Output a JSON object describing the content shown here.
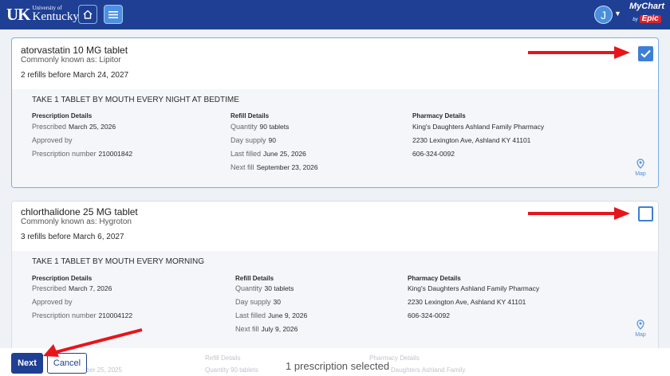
{
  "header": {
    "logo_small": "University of",
    "logo_big": "Kentucky",
    "logo_mark": "UK",
    "avatar_initial": "J",
    "brand_mychart": "MyChart",
    "brand_by": "by",
    "brand_epic": "Epic"
  },
  "prescriptions": [
    {
      "name": "atorvastatin 10 MG tablet",
      "common": "Commonly known as: Lipitor",
      "refills": "2 refills before March 24, 2027",
      "selected": true,
      "sig": "TAKE 1 TABLET BY MOUTH EVERY NIGHT AT BEDTIME",
      "prescription_details": {
        "heading": "Prescription Details",
        "prescribed_label": "Prescribed",
        "prescribed_value": "March 25, 2026",
        "approved_label": "Approved by",
        "rx_number_label": "Prescription number",
        "rx_number_value": "210001842"
      },
      "refill_details": {
        "heading": "Refill Details",
        "quantity_label": "Quantity",
        "quantity_value": "90 tablets",
        "day_supply_label": "Day supply",
        "day_supply_value": "90",
        "last_filled_label": "Last filled",
        "last_filled_value": "June 25, 2026",
        "next_fill_label": "Next fill",
        "next_fill_value": "September 23, 2026"
      },
      "pharmacy_details": {
        "heading": "Pharmacy Details",
        "name": "King's Daughters Ashland Family Pharmacy",
        "address": "2230 Lexington Ave, Ashland KY 41101",
        "phone": "606-324-0092"
      },
      "map_label": "Map"
    },
    {
      "name": "chlorthalidone 25 MG tablet",
      "common": "Commonly known as: Hygroton",
      "refills": "3 refills before March 6, 2027",
      "selected": false,
      "sig": "TAKE 1 TABLET BY MOUTH EVERY MORNING",
      "prescription_details": {
        "heading": "Prescription Details",
        "prescribed_label": "Prescribed",
        "prescribed_value": "March 7, 2026",
        "approved_label": "Approved by",
        "rx_number_label": "Prescription number",
        "rx_number_value": "210004122"
      },
      "refill_details": {
        "heading": "Refill Details",
        "quantity_label": "Quantity",
        "quantity_value": "30 tablets",
        "day_supply_label": "Day supply",
        "day_supply_value": "30",
        "last_filled_label": "Last filled",
        "last_filled_value": "June 9, 2026",
        "next_fill_label": "Next fill",
        "next_fill_value": "July 9, 2026"
      },
      "pharmacy_details": {
        "heading": "Pharmacy Details",
        "name": "King's Daughters Ashland Family Pharmacy",
        "address": "2230 Lexington Ave, Ashland KY 41101",
        "phone": "606-324-0092"
      },
      "map_label": "Map"
    }
  ],
  "ghost_row": {
    "refill_heading": "Refill Details",
    "pharmacy_heading": "Pharmacy Details",
    "date_fragment": "ber 25, 2025",
    "quantity_fragment": "Quantity 90 tablets",
    "pharmacy_fragment": "Daughters Ashland Family"
  },
  "footer": {
    "next_label": "Next",
    "cancel_label": "Cancel",
    "selected_text": "1 prescription selected"
  },
  "colors": {
    "header_bg": "#1f3f94",
    "accent": "#3d7fd6",
    "arrow": "#e8141b"
  }
}
